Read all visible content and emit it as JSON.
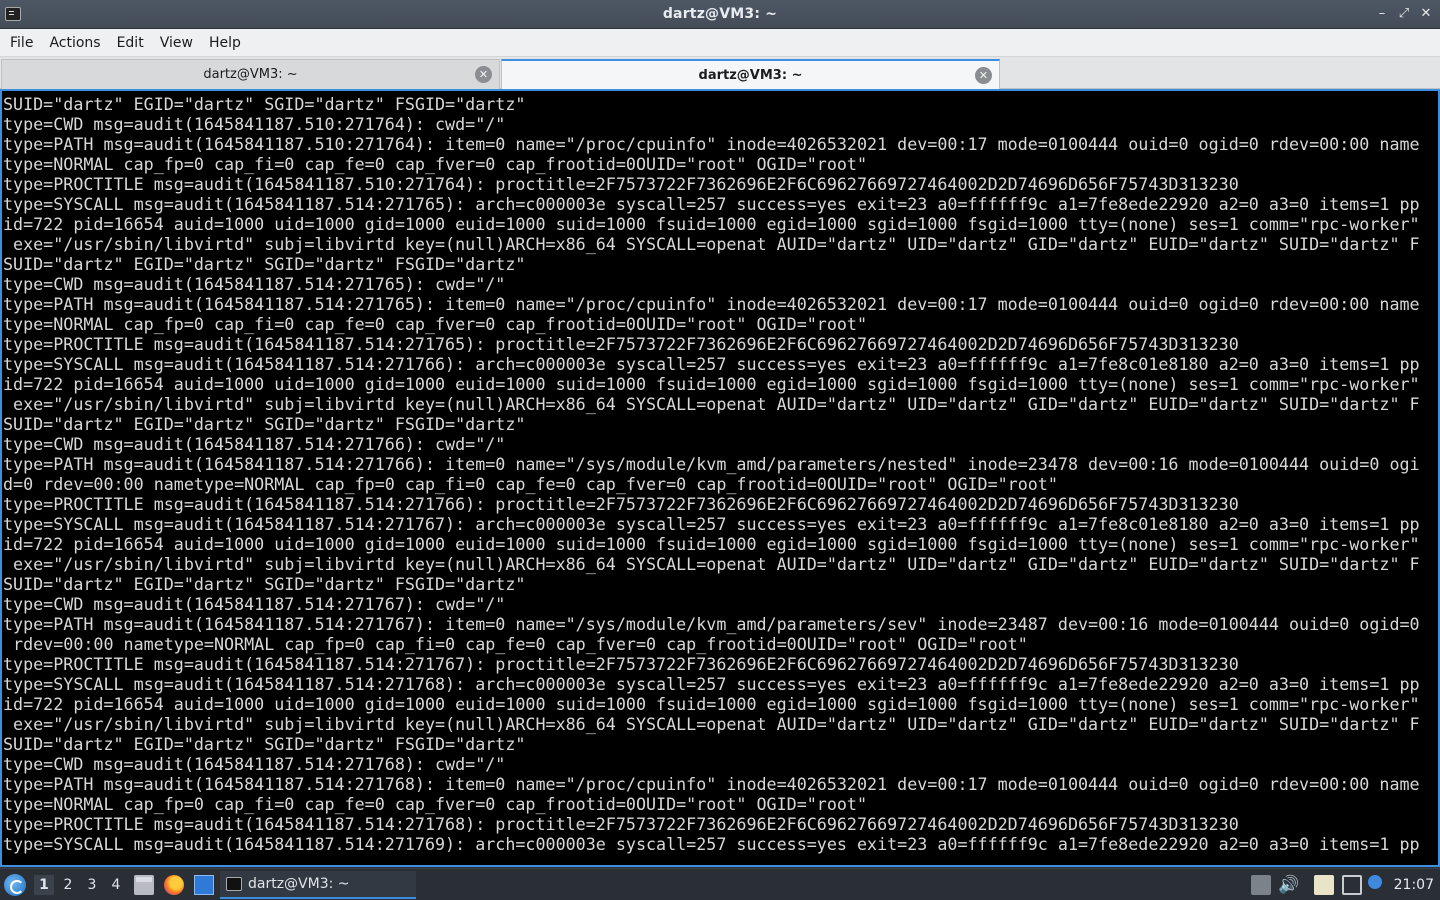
{
  "window": {
    "title": "dartz@VM3: ~"
  },
  "menubar": {
    "items": [
      "File",
      "Actions",
      "Edit",
      "View",
      "Help"
    ]
  },
  "tabs": [
    {
      "label": "dartz@VM3: ~",
      "active": false
    },
    {
      "label": "dartz@VM3: ~",
      "active": true
    }
  ],
  "terminal": {
    "lines": [
      "SUID=\"dartz\" EGID=\"dartz\" SGID=\"dartz\" FSGID=\"dartz\"",
      "type=CWD msg=audit(1645841187.510:271764): cwd=\"/\"",
      "type=PATH msg=audit(1645841187.510:271764): item=0 name=\"/proc/cpuinfo\" inode=4026532021 dev=00:17 mode=0100444 ouid=0 ogid=0 rdev=00:00 name",
      "type=NORMAL cap_fp=0 cap_fi=0 cap_fe=0 cap_fver=0 cap_frootid=0OUID=\"root\" OGID=\"root\"",
      "type=PROCTITLE msg=audit(1645841187.510:271764): proctitle=2F7573722F7362696E2F6C69627669727464002D2D74696D656F75743D313230",
      "type=SYSCALL msg=audit(1645841187.514:271765): arch=c000003e syscall=257 success=yes exit=23 a0=ffffff9c a1=7fe8ede22920 a2=0 a3=0 items=1 pp",
      "id=722 pid=16654 auid=1000 uid=1000 gid=1000 euid=1000 suid=1000 fsuid=1000 egid=1000 sgid=1000 fsgid=1000 tty=(none) ses=1 comm=\"rpc-worker\"",
      " exe=\"/usr/sbin/libvirtd\" subj=libvirtd key=(null)ARCH=x86_64 SYSCALL=openat AUID=\"dartz\" UID=\"dartz\" GID=\"dartz\" EUID=\"dartz\" SUID=\"dartz\" F",
      "SUID=\"dartz\" EGID=\"dartz\" SGID=\"dartz\" FSGID=\"dartz\"",
      "type=CWD msg=audit(1645841187.514:271765): cwd=\"/\"",
      "type=PATH msg=audit(1645841187.514:271765): item=0 name=\"/proc/cpuinfo\" inode=4026532021 dev=00:17 mode=0100444 ouid=0 ogid=0 rdev=00:00 name",
      "type=NORMAL cap_fp=0 cap_fi=0 cap_fe=0 cap_fver=0 cap_frootid=0OUID=\"root\" OGID=\"root\"",
      "type=PROCTITLE msg=audit(1645841187.514:271765): proctitle=2F7573722F7362696E2F6C69627669727464002D2D74696D656F75743D313230",
      "type=SYSCALL msg=audit(1645841187.514:271766): arch=c000003e syscall=257 success=yes exit=23 a0=ffffff9c a1=7fe8c01e8180 a2=0 a3=0 items=1 pp",
      "id=722 pid=16654 auid=1000 uid=1000 gid=1000 euid=1000 suid=1000 fsuid=1000 egid=1000 sgid=1000 fsgid=1000 tty=(none) ses=1 comm=\"rpc-worker\"",
      " exe=\"/usr/sbin/libvirtd\" subj=libvirtd key=(null)ARCH=x86_64 SYSCALL=openat AUID=\"dartz\" UID=\"dartz\" GID=\"dartz\" EUID=\"dartz\" SUID=\"dartz\" F",
      "SUID=\"dartz\" EGID=\"dartz\" SGID=\"dartz\" FSGID=\"dartz\"",
      "type=CWD msg=audit(1645841187.514:271766): cwd=\"/\"",
      "type=PATH msg=audit(1645841187.514:271766): item=0 name=\"/sys/module/kvm_amd/parameters/nested\" inode=23478 dev=00:16 mode=0100444 ouid=0 ogi",
      "d=0 rdev=00:00 nametype=NORMAL cap_fp=0 cap_fi=0 cap_fe=0 cap_fver=0 cap_frootid=0OUID=\"root\" OGID=\"root\"",
      "type=PROCTITLE msg=audit(1645841187.514:271766): proctitle=2F7573722F7362696E2F6C69627669727464002D2D74696D656F75743D313230",
      "type=SYSCALL msg=audit(1645841187.514:271767): arch=c000003e syscall=257 success=yes exit=23 a0=ffffff9c a1=7fe8c01e8180 a2=0 a3=0 items=1 pp",
      "id=722 pid=16654 auid=1000 uid=1000 gid=1000 euid=1000 suid=1000 fsuid=1000 egid=1000 sgid=1000 fsgid=1000 tty=(none) ses=1 comm=\"rpc-worker\"",
      " exe=\"/usr/sbin/libvirtd\" subj=libvirtd key=(null)ARCH=x86_64 SYSCALL=openat AUID=\"dartz\" UID=\"dartz\" GID=\"dartz\" EUID=\"dartz\" SUID=\"dartz\" F",
      "SUID=\"dartz\" EGID=\"dartz\" SGID=\"dartz\" FSGID=\"dartz\"",
      "type=CWD msg=audit(1645841187.514:271767): cwd=\"/\"",
      "type=PATH msg=audit(1645841187.514:271767): item=0 name=\"/sys/module/kvm_amd/parameters/sev\" inode=23487 dev=00:16 mode=0100444 ouid=0 ogid=0",
      " rdev=00:00 nametype=NORMAL cap_fp=0 cap_fi=0 cap_fe=0 cap_fver=0 cap_frootid=0OUID=\"root\" OGID=\"root\"",
      "type=PROCTITLE msg=audit(1645841187.514:271767): proctitle=2F7573722F7362696E2F6C69627669727464002D2D74696D656F75743D313230",
      "type=SYSCALL msg=audit(1645841187.514:271768): arch=c000003e syscall=257 success=yes exit=23 a0=ffffff9c a1=7fe8ede22920 a2=0 a3=0 items=1 pp",
      "id=722 pid=16654 auid=1000 uid=1000 gid=1000 euid=1000 suid=1000 fsuid=1000 egid=1000 sgid=1000 fsgid=1000 tty=(none) ses=1 comm=\"rpc-worker\"",
      " exe=\"/usr/sbin/libvirtd\" subj=libvirtd key=(null)ARCH=x86_64 SYSCALL=openat AUID=\"dartz\" UID=\"dartz\" GID=\"dartz\" EUID=\"dartz\" SUID=\"dartz\" F",
      "SUID=\"dartz\" EGID=\"dartz\" SGID=\"dartz\" FSGID=\"dartz\"",
      "type=CWD msg=audit(1645841187.514:271768): cwd=\"/\"",
      "type=PATH msg=audit(1645841187.514:271768): item=0 name=\"/proc/cpuinfo\" inode=4026532021 dev=00:17 mode=0100444 ouid=0 ogid=0 rdev=00:00 name",
      "type=NORMAL cap_fp=0 cap_fi=0 cap_fe=0 cap_fver=0 cap_frootid=0OUID=\"root\" OGID=\"root\"",
      "type=PROCTITLE msg=audit(1645841187.514:271768): proctitle=2F7573722F7362696E2F6C69627669727464002D2D74696D656F75743D313230",
      "type=SYSCALL msg=audit(1645841187.514:271769): arch=c000003e syscall=257 success=yes exit=23 a0=ffffff9c a1=7fe8ede22920 a2=0 a3=0 items=1 pp"
    ]
  },
  "taskbar": {
    "desktops": [
      "1",
      "2",
      "3",
      "4"
    ],
    "current_desktop": "1",
    "quicklaunch": [
      "files-icon",
      "firefox-icon",
      "desktop-icon"
    ],
    "task_label": "dartz@VM3: ~",
    "clock": "21:07"
  },
  "colors": {
    "accent": "#3d8ee0",
    "terminal_bg": "#000000",
    "terminal_fg": "#d8d8d8",
    "titlebar_bg": "#4a535e",
    "taskbar_bg": "#2a2f36"
  }
}
